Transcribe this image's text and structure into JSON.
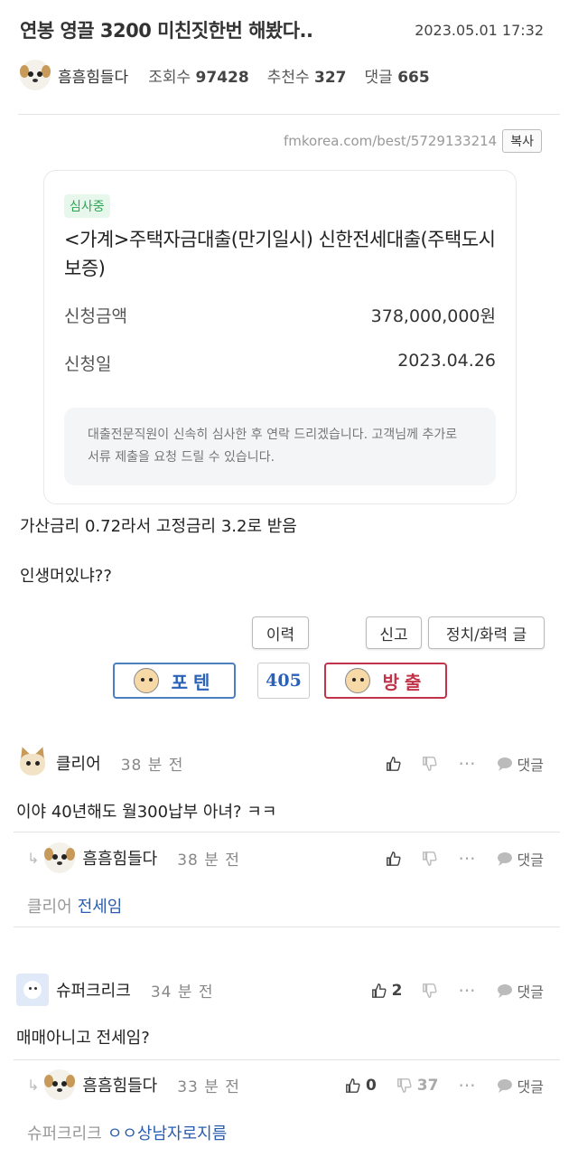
{
  "post": {
    "title": "연봉 영끌 3200 미친짓한번 해봤다..",
    "date": "2023.05.01 17:32",
    "author": "흠흠힘들다",
    "views_label": "조회수",
    "views": "97428",
    "likes_label": "추천수",
    "likes": "327",
    "comments_label": "댓글",
    "comments": "665",
    "source_url": "fmkorea.com/best/5729133214",
    "copy_label": "복사"
  },
  "loan_card": {
    "status": "심사중",
    "title": "<가계>주택자금대출(만기일시) 신한전세대출(주택도시보증)",
    "amount_label": "신청금액",
    "amount": "378,000,000원",
    "date_label": "신청일",
    "date": "2023.04.26",
    "notice": "대출전문직원이 신속히 심사한 후 연락 드리겠습니다. 고객님께 추가로 서류 제출을 요청 드릴 수 있습니다."
  },
  "body": {
    "line1": "가산금리 0.72라서 고정금리 3.2로 받음",
    "line2": "인생머있냐??"
  },
  "buttons": {
    "history": "이력",
    "report": "신고",
    "politics": "정치/화력 글"
  },
  "votes": {
    "up_label": "포텐",
    "count": "405",
    "down_label": "방출"
  },
  "comments": [
    {
      "name": "클리어",
      "time": "38 분 전",
      "text": "이야 40년해도 월300납부 아녀? ㅋㅋ",
      "reply_label": "댓글"
    },
    {
      "name": "흠흠힘들다",
      "time": "38 분 전",
      "mention": "클리어",
      "text": "전세임",
      "reply_label": "댓글"
    },
    {
      "name": "슈퍼크리크",
      "time": "34 분 전",
      "up_count": "2",
      "text": "매매아니고 전세임?",
      "reply_label": "댓글"
    },
    {
      "name": "흠흠힘들다",
      "time": "33 분 전",
      "up_count": "0",
      "down_count": "37",
      "mention": "슈퍼크리크",
      "text": "ㅇㅇ상남자로지름",
      "reply_label": "댓글"
    }
  ],
  "icons": {
    "thumb_up": "thumbs-up-icon",
    "thumb_down": "thumbs-down-icon",
    "more": "more-dots-icon",
    "reply": "speech-bubble-icon",
    "reply_arrow": "reply-arrow-icon"
  }
}
